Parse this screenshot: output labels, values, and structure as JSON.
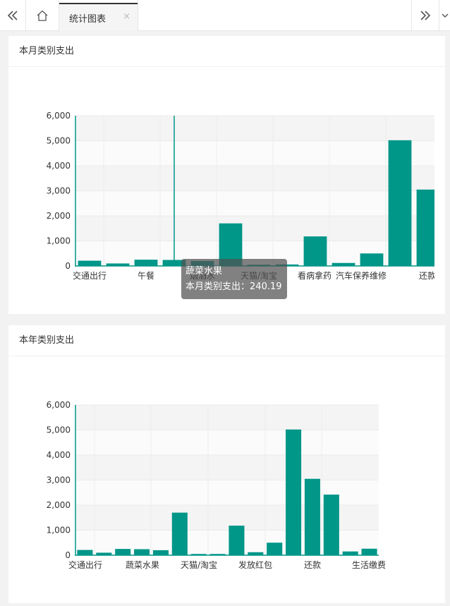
{
  "tabs": {
    "active_label": "统计图表",
    "close_glyph": "×",
    "icons": [
      "double-chevron-left-icon",
      "home-icon",
      "double-chevron-right-icon",
      "chevron-down-icon"
    ]
  },
  "panels": [
    {
      "title": "本月类别支出"
    },
    {
      "title": "本年类别支出"
    }
  ],
  "tooltip": {
    "category": "蔬菜水果",
    "series_label": "本月类别支出",
    "value_text": "240.19"
  },
  "colors": {
    "bar": "#009688",
    "axis": "#009688",
    "tooltip_bg": "#505050"
  },
  "chart_data": [
    {
      "type": "bar",
      "title": "本月类别支出",
      "y_ticks": [
        "0",
        "1,000",
        "2,000",
        "3,000",
        "4,000",
        "5,000",
        "6,000"
      ],
      "ylim": [
        0,
        6000
      ],
      "categories": [
        "交通出行",
        "",
        "午餐",
        "蔬菜水果",
        "",
        "烟酒",
        "天猫/淘宝",
        "",
        "看病拿药",
        "汽车保养维修",
        "",
        "",
        "还款"
      ],
      "visible_x_labels": [
        "交通出行",
        "午餐",
        "烟酒水",
        "天猫/淘宝",
        "看病拿药",
        "汽车保养维修",
        "还款"
      ],
      "values": [
        210,
        100,
        250,
        240.19,
        200,
        1700,
        50,
        60,
        1180,
        120,
        500,
        5020,
        3050
      ],
      "highlight_index": 3,
      "grid": true
    },
    {
      "type": "bar",
      "title": "本年类别支出",
      "y_ticks": [
        "0",
        "1,000",
        "2,000",
        "3,000",
        "4,000",
        "5,000",
        "6,000"
      ],
      "ylim": [
        0,
        6000
      ],
      "visible_x_labels": [
        "交通出行",
        "蔬菜水果",
        "天猫/淘宝",
        "发放红包",
        "还款",
        "生活缴费"
      ],
      "values": [
        210,
        100,
        250,
        240,
        200,
        1700,
        50,
        50,
        1180,
        120,
        500,
        5020,
        3050,
        2420,
        150,
        260
      ],
      "grid": true
    }
  ]
}
